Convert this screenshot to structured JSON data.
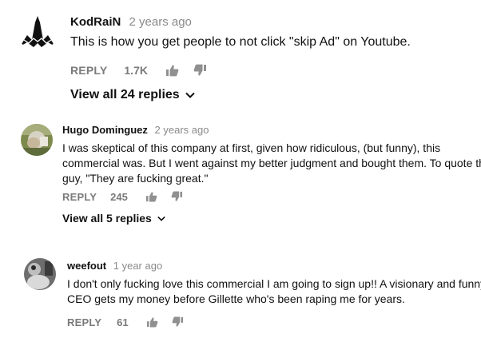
{
  "comments": [
    {
      "author": "KodRaiN",
      "time": "2 years ago",
      "text": "This is how you get people to not click \"skip Ad\" on Youtube.",
      "reply_label": "REPLY",
      "likes": "1.7K",
      "view_replies": "View all 24 replies"
    },
    {
      "author": "Hugo Dominguez",
      "time": "2 years ago",
      "text_lines": [
        "I was skeptical of this company at first, given how ridiculous, (but funny), this",
        "commercial was. But I went against my better judgment and bought them. To quote this",
        "guy, \"They are fucking great.\""
      ],
      "reply_label": "REPLY",
      "likes": "245",
      "view_replies": "View all 5 replies"
    },
    {
      "author": "weefout",
      "time": "1 year ago",
      "text_lines": [
        "I don't only fucking love this commercial I am going to sign up!!  A visionary and funny",
        "CEO gets my money before Gillette who's been raping me for years."
      ],
      "reply_label": "REPLY",
      "likes": "61"
    }
  ],
  "icons": {
    "like": "thumbs-up-icon",
    "dislike": "thumbs-down-icon",
    "expand": "chevron-down-icon"
  },
  "colors": {
    "author": "#111111",
    "muted": "#8a8a8a",
    "action": "#7a7a7a"
  }
}
